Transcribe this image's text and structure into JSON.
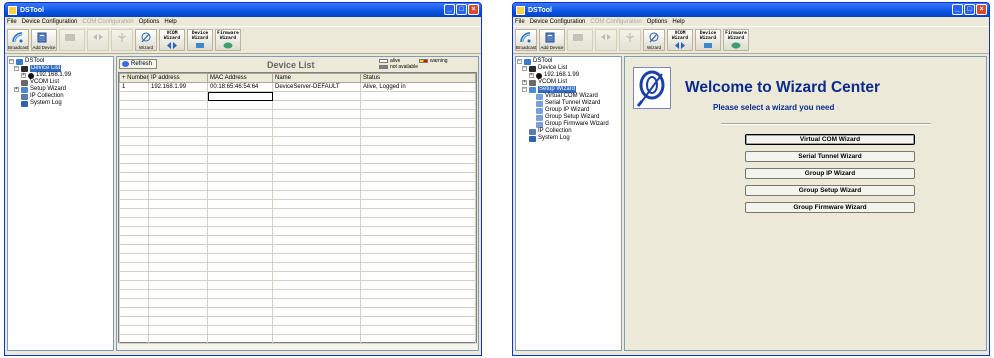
{
  "app": {
    "title": "DSTool"
  },
  "menu": [
    "File",
    "Device Configuration",
    "COM Configuration",
    "Options",
    "Help"
  ],
  "toolbar": {
    "broadcast": "Broadcast",
    "add_device": "Add Device",
    "wizard": "Wizard",
    "vcom_wizard": "VCOM Wizard",
    "device_wizard": "Device Wizard",
    "firmware_wizard": "Firmware Wizard"
  },
  "tree": {
    "root": "DSTool",
    "device_list": "Device List",
    "device_ip": "192.168.1.99",
    "vcom_list": "VCOM List",
    "setup_wizard": "Setup Wizard",
    "ip_collection": "IP Collection",
    "system_log": "System Log",
    "wizards": [
      "Virtual COM Wizard",
      "Serial Tunnel Wizard",
      "Group IP Wizard",
      "Group Setup Wizard",
      "Group Firmware Wizard"
    ]
  },
  "device_list": {
    "refresh_label": "Refresh",
    "title": "Device List",
    "legend": {
      "alive": "alive",
      "not_available": "not available",
      "warning": "warning"
    },
    "columns": [
      "+ Number",
      "IP address",
      "MAC Address",
      "Name",
      "Status"
    ],
    "rows": [
      [
        "1",
        "192.168.1.99",
        "00:18:65:46:54:64",
        "DeviceServer-DEFAULT",
        "Alive, Logged in"
      ]
    ]
  },
  "wizard_center": {
    "title": "Welcome to Wizard Center",
    "subtitle": "Please select a wizard you need",
    "buttons": [
      "Virtual COM Wizard",
      "Serial Tunnel Wizard",
      "Group IP Wizard",
      "Group Setup Wizard",
      "Group Firmware Wizard"
    ]
  },
  "colors": {
    "title_bar": "#0a52e0",
    "alive": "#ffffff",
    "not_available": "#808080",
    "warning_a": "#ffe000",
    "warning_b": "#e00000",
    "wizard_text": "#0a2a8e"
  }
}
